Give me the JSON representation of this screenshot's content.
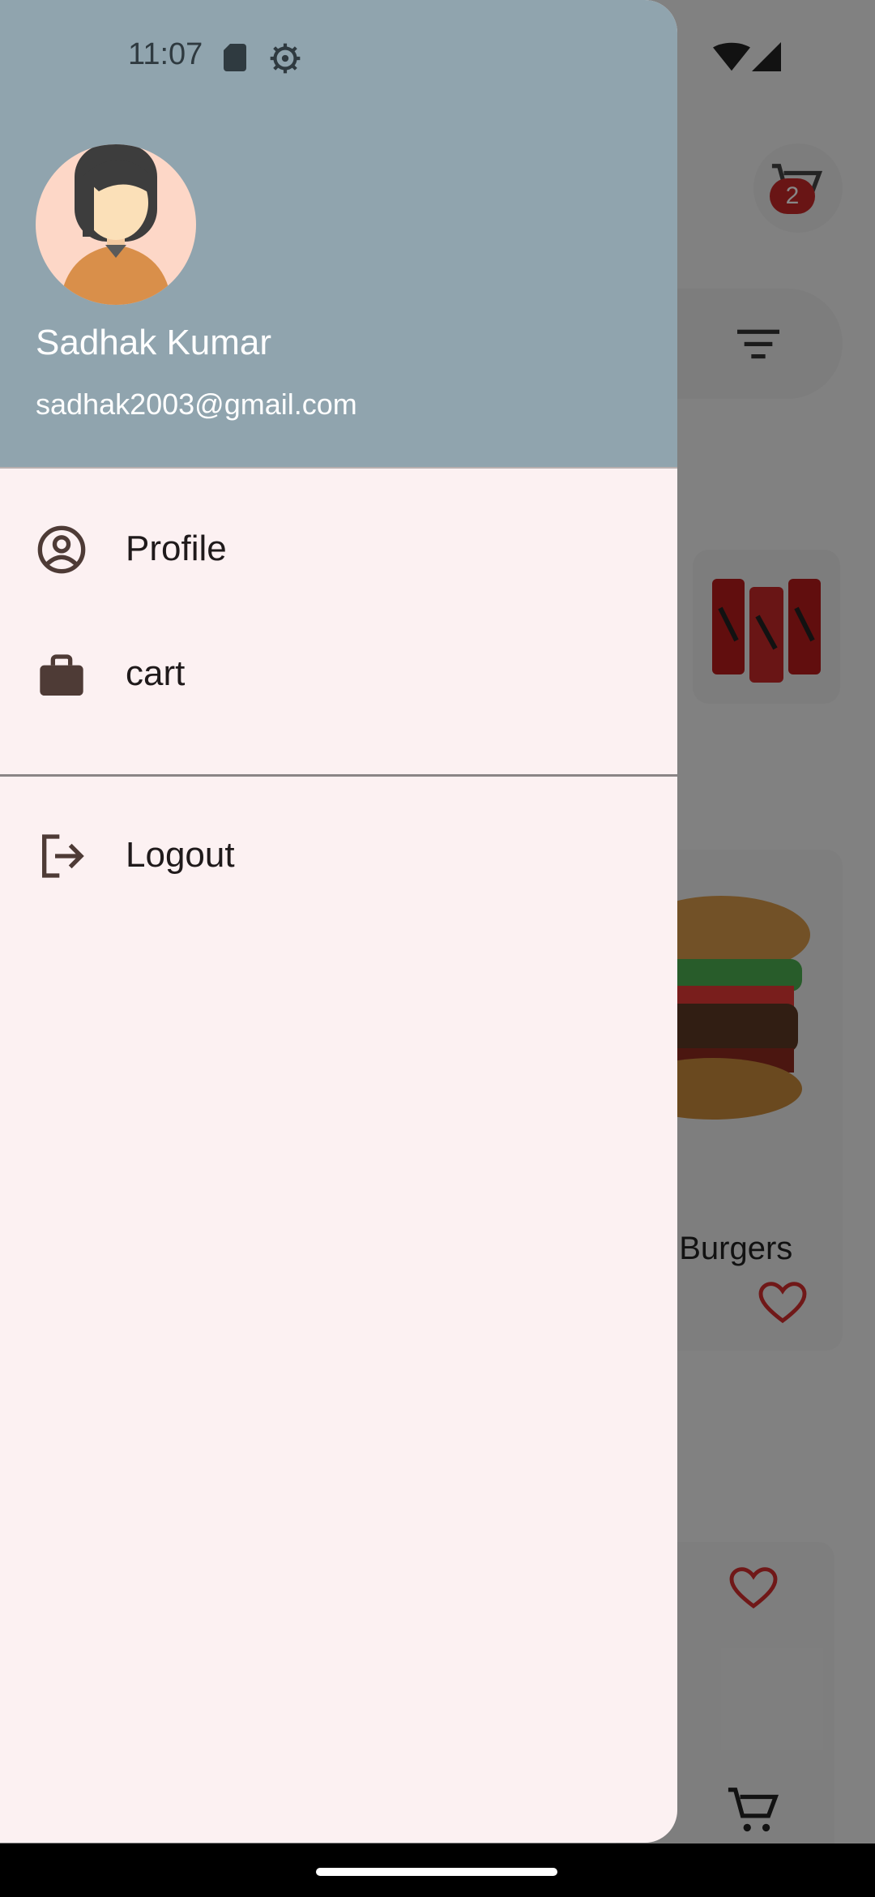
{
  "status_bar": {
    "time": "11:07",
    "left_icons": [
      "sd-card-icon",
      "settings-gear-icon"
    ],
    "right_icons": [
      "wifi-icon",
      "cellular-signal-icon"
    ]
  },
  "drawer": {
    "header": {
      "avatar": "user-avatar-female",
      "name": "Sadhak Kumar",
      "email": "sadhak2003@gmail.com",
      "background_color": "#90a4ae"
    },
    "menu_items": [
      {
        "label": "Profile",
        "icon": "account-circle-icon"
      },
      {
        "label": "cart",
        "icon": "briefcase-icon"
      }
    ],
    "footer_items": [
      {
        "label": "Logout",
        "icon": "logout-icon"
      }
    ],
    "background_color": "#fcf1f2"
  },
  "background_app": {
    "cart_badge_count": "2",
    "visible_card_title_fragment": "t Burgers",
    "accent_color": "#c62828"
  }
}
